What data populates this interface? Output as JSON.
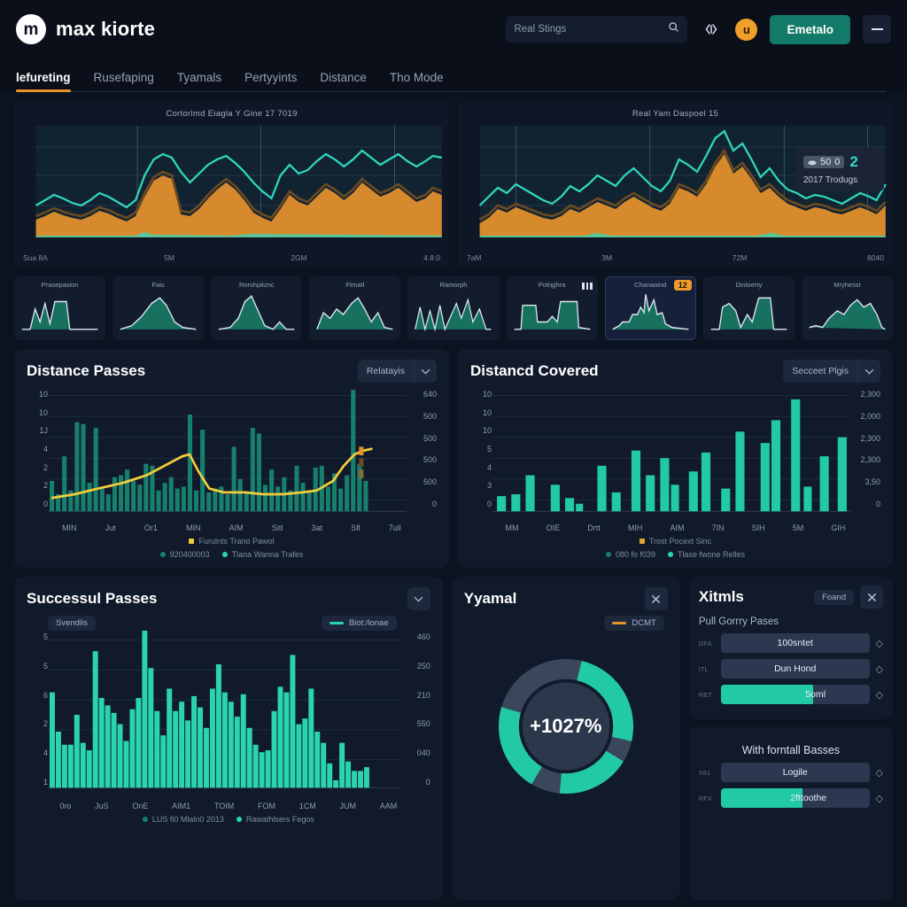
{
  "header": {
    "logo_glyph": "m",
    "brand": "max kiorte",
    "search_placeholder": "Real Stings",
    "search_value": "",
    "search_icon": "search-icon",
    "code_icon": "code-brackets-icon",
    "avatar_glyph": "u",
    "primary_button": "Emetalo",
    "menu_icon": "hamburger-menu-icon"
  },
  "tabs": [
    {
      "label": "lefureting",
      "active": true
    },
    {
      "label": "Rusefaping",
      "active": false
    },
    {
      "label": "Tyamals",
      "active": false
    },
    {
      "label": "Pertyyints",
      "active": false
    },
    {
      "label": "Distance",
      "active": false
    },
    {
      "label": "Tho Mode",
      "active": false
    }
  ],
  "hero": {
    "left": {
      "title": "Cortorlmd Eiagla Y Gine 17 7019",
      "xticks": [
        "Sua 8A",
        "5M",
        "2GM",
        "4.8:0"
      ]
    },
    "right": {
      "title": "Real Yam Daspoel 15",
      "xticks": [
        "7aM",
        "3M",
        "72M",
        "8040"
      ],
      "tooltip": {
        "chip_value": "50",
        "chip_extra": "0",
        "big_value": "2",
        "sub": "2017 Trodugs"
      }
    }
  },
  "thumbnails": [
    {
      "label": "Prasepaxion",
      "badge": "",
      "selected": false,
      "bars": false
    },
    {
      "label": "Fais",
      "badge": "",
      "selected": false,
      "bars": false
    },
    {
      "label": "Rorshpitznc",
      "badge": "",
      "selected": false,
      "bars": false
    },
    {
      "label": "Ftmatl",
      "badge": "",
      "selected": false,
      "bars": false
    },
    {
      "label": "Ramorph",
      "badge": "",
      "selected": false,
      "bars": false
    },
    {
      "label": "Potrgjhra",
      "badge": "",
      "selected": false,
      "bars": true
    },
    {
      "label": "Chanaaind",
      "badge": "12",
      "selected": true,
      "bars": false
    },
    {
      "label": "Dintoerty",
      "badge": "",
      "selected": false,
      "bars": false
    },
    {
      "label": "Mryhesst",
      "badge": "",
      "selected": false,
      "bars": false
    }
  ],
  "cards": {
    "distance_passes": {
      "title": "Distance Passes",
      "select_label": "Relatayis",
      "caret_icon": "chevron-down-icon",
      "yticks_left": [
        "10",
        "10",
        "1J",
        "4",
        "2",
        "2",
        "0"
      ],
      "yticks_right": [
        "640",
        "500",
        "500",
        "500",
        "500",
        "0"
      ],
      "xticks": [
        "MIN",
        "Jut",
        "Or1",
        "MIN",
        "AIM",
        "Sitl",
        "3at",
        "Sfl",
        "7ull"
      ],
      "legend_line": "Furulnts Trano Pawol",
      "legend_a": "920400003",
      "legend_b": "Tlana Wanna Trafes"
    },
    "distance_covered": {
      "title": "Distancd Covered",
      "select_label": "Secceet Plgis",
      "caret_icon": "chevron-down-icon",
      "yticks_left": [
        "10",
        "10",
        "10",
        "5",
        "4",
        "3",
        "0"
      ],
      "yticks_right": [
        "2,300",
        "2,000",
        "2,300",
        "2,300",
        "3,50",
        "0"
      ],
      "xticks": [
        "MM",
        "OIE",
        "Drtt",
        "MIH",
        "AIM",
        "7IN",
        "SIH",
        "5M",
        "GIH"
      ],
      "legend_line": "Trost Pocext Sinc",
      "legend_a": "080 fo f039",
      "legend_b": "Tlase fwone Relles"
    },
    "successful_passes": {
      "title": "Successul Passes",
      "badge": "Svendlis",
      "legend_chip": "Biot:/lonae",
      "caret_icon": "chevron-down-icon",
      "yticks_left": [
        "5",
        "5",
        "6",
        "2",
        "4",
        "1"
      ],
      "yticks_right": [
        "460",
        "250",
        "210",
        "550",
        "040",
        "0"
      ],
      "xticks": [
        "0ro",
        "JuS",
        "OnE",
        "AIM1",
        "TOIM",
        "FOM",
        "1CM",
        "JUM",
        "AAM"
      ],
      "legend_a": "LUS fi0 Mlaln0 2013",
      "legend_b": "Rawathlsers Fegos"
    },
    "yyamal": {
      "title": "Yyamal",
      "close_icon": "close-icon",
      "legend_chip": "DCMT",
      "center_value": "+1027%"
    },
    "xitmls": {
      "title": "Xitmls",
      "action_label": "Foand",
      "close_icon": "close-icon",
      "section_one": "Pull Gorrry Pases",
      "rows_one": [
        {
          "key": "DFA",
          "label": "100sntet",
          "fill": 0
        },
        {
          "key": "ITL",
          "label": "Dun Hond",
          "fill": 0
        },
        {
          "key": "RET",
          "label": "5oml",
          "fill": 62
        }
      ],
      "section_two": "With forntall Basses",
      "rows_two": [
        {
          "key": "X61",
          "label": "Logile",
          "fill": 0
        },
        {
          "key": "RFX",
          "label": "2fttoothe",
          "fill": 55
        }
      ],
      "caret_icon": "diamond-caret-icon"
    }
  },
  "colors": {
    "accent_teal": "#22c9a5",
    "accent_orange": "#e8922a",
    "amber": "#efa43a",
    "bg": "#0b1220",
    "panel": "#111a2b"
  },
  "chart_data": [
    {
      "type": "area",
      "id": "hero-left",
      "title": "Cortorlmd Eiagla Y Gine 17 7019",
      "xlabel": "",
      "ylabel": "",
      "xticks": [
        "Sua 8A",
        "5M",
        "2GM",
        "4.8:0"
      ],
      "grid": true,
      "legend": "none",
      "series": [
        {
          "name": "teal-line",
          "color": "#2fd9bd",
          "values": [
            34,
            40,
            46,
            42,
            38,
            36,
            40,
            48,
            44,
            38,
            34,
            40,
            58,
            70,
            76,
            72,
            62,
            52,
            58,
            66,
            72,
            76,
            70,
            62,
            52,
            44,
            38,
            50,
            66,
            60,
            56,
            64,
            72,
            68,
            62,
            70,
            78,
            72,
            66,
            70,
            74,
            68,
            62,
            66,
            72,
            70,
            66,
            70
          ]
        },
        {
          "name": "amber-area",
          "color": "#efa43a",
          "values": [
            22,
            26,
            32,
            28,
            24,
            22,
            26,
            32,
            30,
            24,
            20,
            26,
            42,
            56,
            60,
            56,
            30,
            28,
            34,
            44,
            52,
            58,
            52,
            42,
            32,
            26,
            22,
            34,
            48,
            42,
            38,
            46,
            54,
            50,
            44,
            50,
            58,
            52,
            46,
            50,
            54,
            48,
            42,
            46,
            52,
            50,
            46,
            50
          ]
        },
        {
          "name": "dark-line",
          "color": "#6b4a22",
          "values": [
            24,
            28,
            34,
            30,
            26,
            24,
            28,
            34,
            32,
            26,
            22,
            28,
            44,
            58,
            62,
            58,
            32,
            30,
            36,
            46,
            54,
            60,
            54,
            44,
            34,
            28,
            24,
            36,
            50,
            44,
            40,
            48,
            56,
            52,
            46,
            52,
            60,
            54,
            48,
            52,
            56,
            50,
            44,
            48,
            54,
            52,
            48,
            52
          ]
        }
      ],
      "ylim": [
        0,
        100
      ]
    },
    {
      "type": "area",
      "id": "hero-right",
      "title": "Real Yam Daspoel 15",
      "xticks": [
        "7aM",
        "3M",
        "72M",
        "8040"
      ],
      "grid": true,
      "legend": "none",
      "annotation": {
        "chip": "50",
        "value": "2",
        "sub": "2017 Trodugs"
      },
      "series": [
        {
          "name": "teal-line",
          "color": "#2fd9bd",
          "values": [
            34,
            42,
            50,
            46,
            52,
            48,
            44,
            40,
            36,
            42,
            50,
            46,
            52,
            58,
            54,
            50,
            58,
            64,
            58,
            52,
            48,
            56,
            70,
            66,
            60,
            72,
            86,
            94,
            76,
            82,
            70,
            58,
            76,
            62,
            54,
            50,
            48,
            52,
            48,
            44,
            42,
            46,
            50,
            46,
            42,
            46,
            52,
            58
          ]
        },
        {
          "name": "amber-area",
          "color": "#efa43a",
          "values": [
            20,
            26,
            34,
            30,
            36,
            32,
            28,
            24,
            22,
            26,
            34,
            30,
            36,
            42,
            38,
            34,
            42,
            48,
            42,
            36,
            32,
            40,
            54,
            50,
            44,
            56,
            70,
            78,
            60,
            66,
            54,
            42,
            46,
            38,
            34,
            30,
            28,
            32,
            30,
            26,
            24,
            28,
            32,
            28,
            24,
            28,
            32,
            38
          ]
        },
        {
          "name": "dark-line",
          "color": "#6b4a22",
          "values": [
            22,
            28,
            36,
            32,
            38,
            34,
            30,
            26,
            24,
            28,
            36,
            32,
            38,
            44,
            40,
            36,
            44,
            50,
            44,
            38,
            34,
            42,
            56,
            52,
            46,
            58,
            72,
            80,
            62,
            68,
            56,
            44,
            48,
            40,
            36,
            32,
            30,
            34,
            32,
            28,
            26,
            30,
            34,
            30,
            26,
            30,
            34,
            40
          ]
        }
      ],
      "ylim": [
        0,
        100
      ]
    },
    {
      "type": "bar",
      "id": "distance-passes",
      "title": "Distance Passes",
      "xticks": [
        "MIN",
        "Jut",
        "Or1",
        "MIN",
        "AIM",
        "Sitl",
        "3at",
        "Sfl",
        "7ull"
      ],
      "yticks_left": [
        "10",
        "10",
        "1J",
        "4",
        "2",
        "2",
        "0"
      ],
      "yticks_right": [
        "640",
        "500",
        "500",
        "500",
        "500",
        "0"
      ],
      "bar_color": "#17806d",
      "line_color": "#f2cd3a",
      "bars": [
        23,
        14,
        42,
        18,
        72,
        70,
        30,
        68,
        22,
        14,
        32,
        34,
        42,
        30,
        26,
        45,
        44,
        18,
        28,
        33,
        22,
        24,
        86,
        20,
        68,
        18,
        22,
        24,
        16,
        52,
        30,
        18,
        70,
        62,
        26,
        40,
        22,
        32,
        20,
        46,
        26,
        18,
        44,
        45,
        22,
        35,
        20,
        34,
        100,
        48,
        30
      ],
      "line": [
        18,
        19,
        20,
        22,
        23,
        24,
        26,
        28,
        29,
        30,
        31,
        33,
        35,
        37,
        39,
        42,
        46,
        50,
        49,
        40,
        28,
        20,
        17,
        16,
        16,
        16,
        17,
        17,
        16,
        15,
        15,
        14,
        15,
        16,
        17,
        17,
        18,
        19,
        20,
        22,
        26,
        34,
        44,
        52,
        57,
        60,
        62,
        64,
        65,
        66,
        67
      ],
      "ylim": [
        0,
        100
      ]
    },
    {
      "type": "bar",
      "id": "distance-covered",
      "title": "Distancd Covered",
      "xticks": [
        "MM",
        "OIE",
        "Drtt",
        "MIH",
        "AIM",
        "7IN",
        "SIH",
        "5M",
        "GIH"
      ],
      "yticks_left": [
        "10",
        "10",
        "10",
        "5",
        "4",
        "3",
        "0"
      ],
      "yticks_right": [
        "2,300",
        "2,000",
        "2,300",
        "2,300",
        "3,50",
        "0"
      ],
      "bar_color": "#22c9a5",
      "bars": [
        12,
        14,
        30,
        0,
        22,
        10,
        5,
        0,
        38,
        16,
        0,
        48,
        30,
        0,
        42,
        28,
        38,
        45,
        0,
        22,
        0,
        62,
        0,
        0,
        52,
        50,
        0,
        58,
        72,
        0,
        98,
        22,
        0,
        40,
        0,
        0,
        58
      ],
      "ylim": [
        0,
        100
      ]
    },
    {
      "type": "bar",
      "id": "successful-passes",
      "title": "Successul Passes",
      "xticks": [
        "0ro",
        "JuS",
        "OnE",
        "AIM1",
        "TOIM",
        "FOM",
        "1CM",
        "JUM",
        "AAM"
      ],
      "yticks_left": [
        "5",
        "5",
        "6",
        "2",
        "4",
        "1"
      ],
      "yticks_right": [
        "460",
        "250",
        "210",
        "550",
        "040",
        "0"
      ],
      "bar_color": "#2ad4b0",
      "bars": [
        62,
        40,
        34,
        34,
        50,
        36,
        32,
        80,
        40,
        62,
        56,
        50,
        36,
        44,
        62,
        108,
        72,
        56,
        44,
        60,
        66,
        58,
        44,
        70,
        62,
        56,
        62,
        44,
        44,
        66,
        78,
        64,
        46,
        56,
        66,
        36,
        34,
        36,
        58,
        72,
        66,
        88,
        50,
        58,
        38,
        64,
        40,
        28,
        24,
        20,
        22,
        22
      ],
      "ylim": [
        0,
        110
      ]
    },
    {
      "type": "pie",
      "id": "yyamal-donut",
      "title": "Yyamal",
      "center_label": "+1027%",
      "labels": [
        "segment-a",
        "segment-b",
        "segment-c",
        "gap"
      ],
      "values": [
        34,
        22,
        26,
        18
      ],
      "colors": [
        "#22c9a5",
        "#22c9a5",
        "#22c9a5",
        "#39465c"
      ]
    }
  ]
}
